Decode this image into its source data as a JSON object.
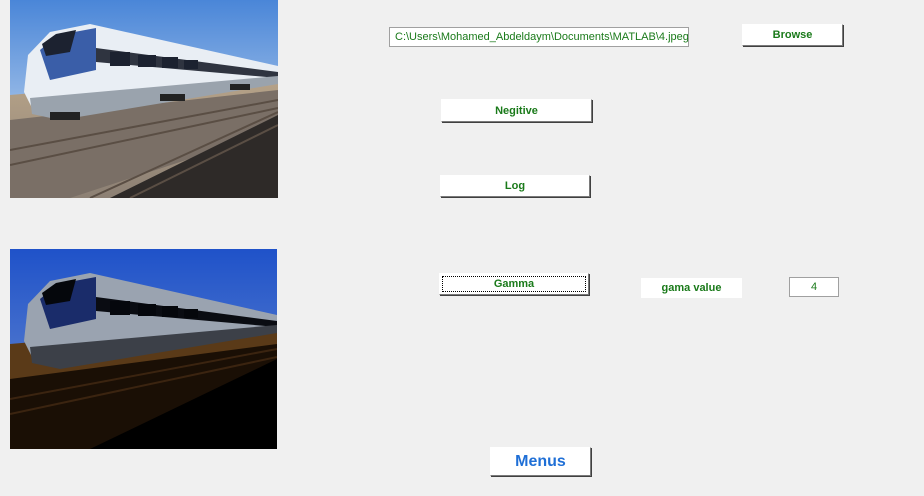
{
  "controls": {
    "path_value": "C:\\Users\\Mohamed_Abdeldaym\\Documents\\MATLAB\\4.jpeg",
    "browse_label": "Browse",
    "negative_label": "Negitive",
    "log_label": "Log",
    "gamma_label": "Gamma",
    "gamma_value_label": "gama value",
    "gamma_value": "4",
    "menus_label": "Menus"
  },
  "colors": {
    "label_text": "#1a7a1a",
    "menus_text": "#1f6fd6",
    "background": "#f0f0f0"
  },
  "images": {
    "original": "train-photo",
    "processed": "train-photo-gamma-processed"
  }
}
